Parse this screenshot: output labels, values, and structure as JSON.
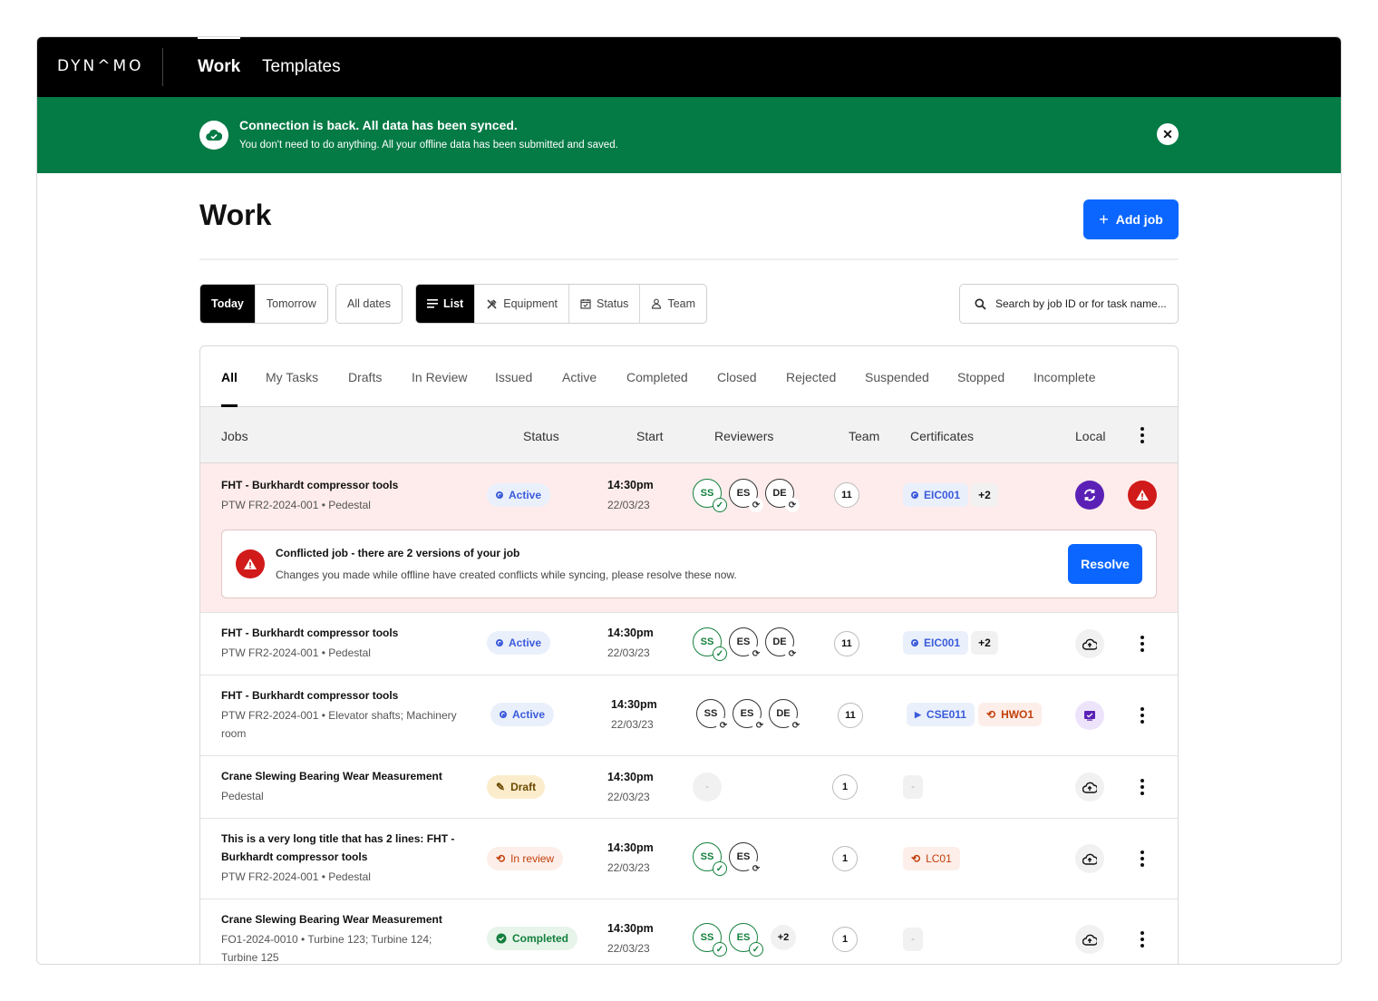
{
  "app": {
    "logo": "DYN^MO"
  },
  "nav": {
    "tabs": [
      {
        "label": "Work"
      },
      {
        "label": "Templates"
      }
    ]
  },
  "banner": {
    "title": "Connection is back. All data has been synced.",
    "text": "You don't need to do anything. All your offline data has been submitted and saved.",
    "close": "✕"
  },
  "page": {
    "title": "Work",
    "add_job": "Add job"
  },
  "date_filter": {
    "items": [
      "Today",
      "Tomorrow"
    ],
    "all_dates": "All dates"
  },
  "view_toggle": {
    "items": [
      "List",
      "Equipment",
      "Status",
      "Team"
    ]
  },
  "search": {
    "placeholder": "Search by job ID or for task name..."
  },
  "status_tabs": [
    "All",
    "My Tasks",
    "Drafts",
    "In Review",
    "Issued",
    "Active",
    "Completed",
    "Closed",
    "Rejected",
    "Suspended",
    "Stopped",
    "Incomplete"
  ],
  "columns": {
    "jobs": "Jobs",
    "status": "Status",
    "start": "Start",
    "reviewers": "Reviewers",
    "team": "Team",
    "certificates": "Certificates",
    "local": "Local"
  },
  "conflict": {
    "title": "Conflicted job - there are 2 versions of your job",
    "text": "Changes you made while offline have created conflicts while syncing, please resolve these now.",
    "resolve": "Resolve"
  },
  "rows": [
    {
      "title": "FHT - Burkhardt compressor tools",
      "subtitle": "PTW FR2-2024-001 • Pedestal",
      "status": "Active",
      "time": "14:30pm",
      "date": "22/03/23",
      "reviewers": [
        "SS",
        "ES",
        "DE"
      ],
      "team": "11",
      "certs": [
        "EIC001"
      ],
      "certs_more": "+2",
      "local": "sync"
    },
    {
      "title": "FHT - Burkhardt compressor tools",
      "subtitle": "PTW FR2-2024-001 • Pedestal",
      "status": "Active",
      "time": "14:30pm",
      "date": "22/03/23",
      "reviewers": [
        "SS",
        "ES",
        "DE"
      ],
      "team": "11",
      "certs": [
        "EIC001"
      ],
      "certs_more": "+2",
      "local": "cloud"
    },
    {
      "title": "FHT - Burkhardt compressor tools",
      "subtitle": "PTW FR2-2024-001 • Elevator shafts; Machinery room",
      "status": "Active",
      "time": "14:30pm",
      "date": "22/03/23",
      "reviewers": [
        "SS",
        "ES",
        "DE"
      ],
      "team": "11",
      "certs": [
        "CSE011",
        "HWO1"
      ],
      "local": "screen"
    },
    {
      "title": "Crane Slewing Bearing Wear Measurement",
      "subtitle": "Pedestal",
      "status": "Draft",
      "time": "14:30pm",
      "date": "22/03/23",
      "reviewers_empty": "-",
      "team": "1",
      "certs_empty": "-",
      "local": "cloud"
    },
    {
      "title": "This is a very long title that has 2 lines: FHT - Burkhardt compressor tools",
      "subtitle": "PTW FR2-2024-001 • Pedestal",
      "status": "In review",
      "time": "14:30pm",
      "date": "22/03/23",
      "reviewers": [
        "SS",
        "ES"
      ],
      "team": "1",
      "certs": [
        "LC01"
      ],
      "local": "cloud"
    },
    {
      "title": "Crane Slewing Bearing Wear Measurement",
      "subtitle": "FO1-2024-0010 • Turbine 123; Turbine 124; Turbine 125",
      "status": "Completed",
      "time": "14:30pm",
      "date": "22/03/23",
      "reviewers": [
        "SS",
        "ES"
      ],
      "reviewers_more": "+2",
      "team": "1",
      "certs_empty": "-",
      "local": "cloud"
    }
  ],
  "colors": {
    "accent": "#0a66ff",
    "banner": "#047a45",
    "danger": "#d11a1a",
    "sync": "#5b21b6"
  }
}
